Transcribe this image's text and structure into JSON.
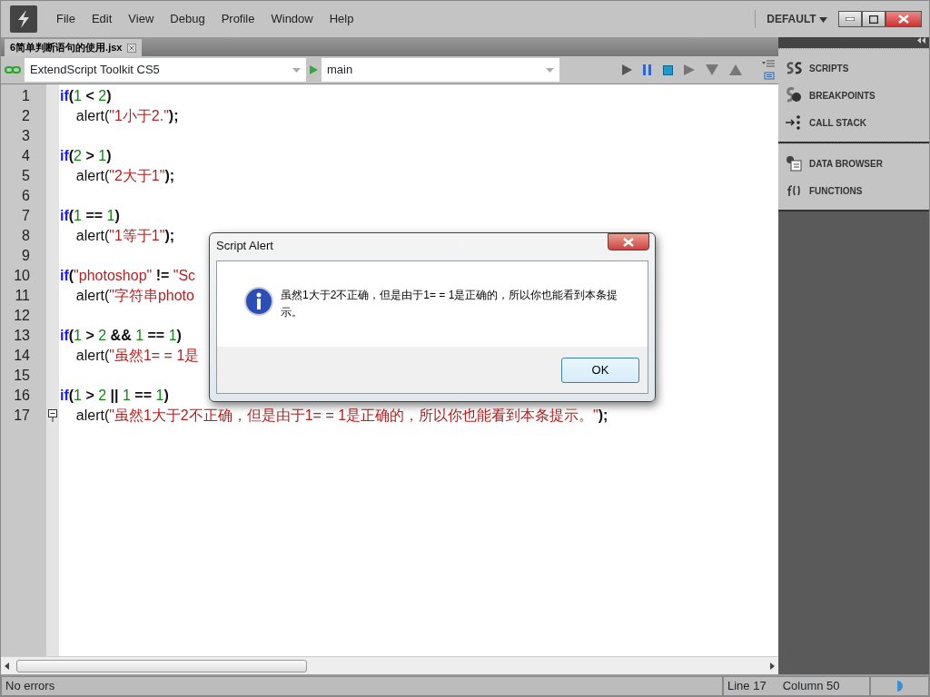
{
  "menu": [
    "File",
    "Edit",
    "View",
    "Debug",
    "Profile",
    "Window",
    "Help"
  ],
  "workspace": "DEFAULT",
  "tabs": [
    {
      "label": "6简单判断语句的使用.jsx",
      "selected": true
    }
  ],
  "target": {
    "value": "ExtendScript Toolkit CS5"
  },
  "engine": {
    "value": "main"
  },
  "panel_groups": [
    {
      "items": [
        {
          "label": "SCRIPTS",
          "kind": "scripts"
        },
        {
          "label": "BREAKPOINTS",
          "kind": "breakpoints"
        },
        {
          "label": "CALL STACK",
          "kind": "callstack"
        }
      ]
    },
    {
      "items": [
        {
          "label": "DATA BROWSER",
          "kind": "data"
        },
        {
          "label": "FUNCTIONS",
          "kind": "functions"
        }
      ]
    }
  ],
  "code": [
    {
      "number": "1",
      "tokens": [
        {
          "kind": "keyword",
          "text": "if"
        },
        {
          "kind": "punct",
          "text": "("
        },
        {
          "kind": "number",
          "text": "1"
        },
        {
          "kind": "punct",
          "text": " < "
        },
        {
          "kind": "number",
          "text": "2"
        },
        {
          "kind": "punct",
          "text": ")"
        }
      ]
    },
    {
      "number": "2",
      "tokens": [
        {
          "kind": "plain",
          "text": "    alert("
        },
        {
          "kind": "string",
          "text": "\"1小于2.\""
        },
        {
          "kind": "punct",
          "text": ");"
        }
      ]
    },
    {
      "number": "3"
    },
    {
      "number": "4",
      "tokens": [
        {
          "kind": "keyword",
          "text": "if"
        },
        {
          "kind": "punct",
          "text": "("
        },
        {
          "kind": "number",
          "text": "2"
        },
        {
          "kind": "punct",
          "text": " > "
        },
        {
          "kind": "number",
          "text": "1"
        },
        {
          "kind": "punct",
          "text": ")"
        }
      ]
    },
    {
      "number": "5",
      "tokens": [
        {
          "kind": "plain",
          "text": "    alert("
        },
        {
          "kind": "string",
          "text": "\"2大于1\""
        },
        {
          "kind": "punct",
          "text": ");"
        }
      ]
    },
    {
      "number": "6"
    },
    {
      "number": "7",
      "tokens": [
        {
          "kind": "keyword",
          "text": "if"
        },
        {
          "kind": "punct",
          "text": "("
        },
        {
          "kind": "number",
          "text": "1"
        },
        {
          "kind": "punct",
          "text": " == "
        },
        {
          "kind": "number",
          "text": "1"
        },
        {
          "kind": "punct",
          "text": ")"
        }
      ]
    },
    {
      "number": "8",
      "tokens": [
        {
          "kind": "plain",
          "text": "    alert("
        },
        {
          "kind": "string",
          "text": "\"1等于1\""
        },
        {
          "kind": "punct",
          "text": ");"
        }
      ]
    },
    {
      "number": "9"
    },
    {
      "number": "10",
      "tokens": [
        {
          "kind": "keyword",
          "text": "if"
        },
        {
          "kind": "punct",
          "text": "("
        },
        {
          "kind": "string",
          "text": "\"photoshop\""
        },
        {
          "kind": "punct",
          "text": " != "
        },
        {
          "kind": "string",
          "text": "\"Sc"
        }
      ]
    },
    {
      "number": "11",
      "tokens": [
        {
          "kind": "plain",
          "text": "    alert("
        },
        {
          "kind": "string",
          "text": "\"字符串photo"
        }
      ]
    },
    {
      "number": "12"
    },
    {
      "number": "13",
      "tokens": [
        {
          "kind": "keyword",
          "text": "if"
        },
        {
          "kind": "punct",
          "text": "("
        },
        {
          "kind": "number",
          "text": "1"
        },
        {
          "kind": "punct",
          "text": " > "
        },
        {
          "kind": "number",
          "text": "2"
        },
        {
          "kind": "punct",
          "text": " && "
        },
        {
          "kind": "number",
          "text": "1"
        },
        {
          "kind": "punct",
          "text": " == "
        },
        {
          "kind": "number",
          "text": "1"
        },
        {
          "kind": "punct",
          "text": ")"
        }
      ]
    },
    {
      "number": "14",
      "tokens": [
        {
          "kind": "plain",
          "text": "    alert("
        },
        {
          "kind": "string",
          "text": "\"虽然1= = 1是"
        }
      ]
    },
    {
      "number": "15"
    },
    {
      "number": "16",
      "tokens": [
        {
          "kind": "keyword",
          "text": "if"
        },
        {
          "kind": "punct",
          "text": "("
        },
        {
          "kind": "number",
          "text": "1"
        },
        {
          "kind": "punct",
          "text": " > "
        },
        {
          "kind": "number",
          "text": "2"
        },
        {
          "kind": "punct",
          "text": " || "
        },
        {
          "kind": "number",
          "text": "1"
        },
        {
          "kind": "punct",
          "text": " == "
        },
        {
          "kind": "number",
          "text": "1"
        },
        {
          "kind": "punct",
          "text": ")"
        }
      ]
    },
    {
      "number": "17",
      "fold": true,
      "tokens": [
        {
          "kind": "plain",
          "text": "    alert("
        },
        {
          "kind": "string",
          "text": "\"虽然1大于2不正确，但是由于1= = 1是正确的，所以你也能看到本条提示。\""
        },
        {
          "kind": "punct",
          "text": ");"
        }
      ]
    }
  ],
  "dialog": {
    "title": "Script Alert",
    "message": "虽然1大于2不正确，但是由于1= = 1是正确的，所以你也能看到本条提示。",
    "button": "OK"
  },
  "status_bar": {
    "message": "No errors",
    "line": "Line 17",
    "column": "Column 50"
  }
}
